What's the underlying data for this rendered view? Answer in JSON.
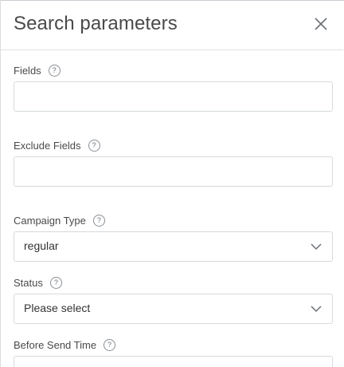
{
  "panel": {
    "title": "Search parameters",
    "close_icon": "close-icon"
  },
  "fields": {
    "fields_label": "Fields",
    "fields_value": "",
    "exclude_label": "Exclude Fields",
    "exclude_value": "",
    "campaign_type_label": "Campaign Type",
    "campaign_type_value": "regular",
    "status_label": "Status",
    "status_value": "Please select",
    "before_send_time_label": "Before Send Time"
  },
  "help_glyph": "?"
}
